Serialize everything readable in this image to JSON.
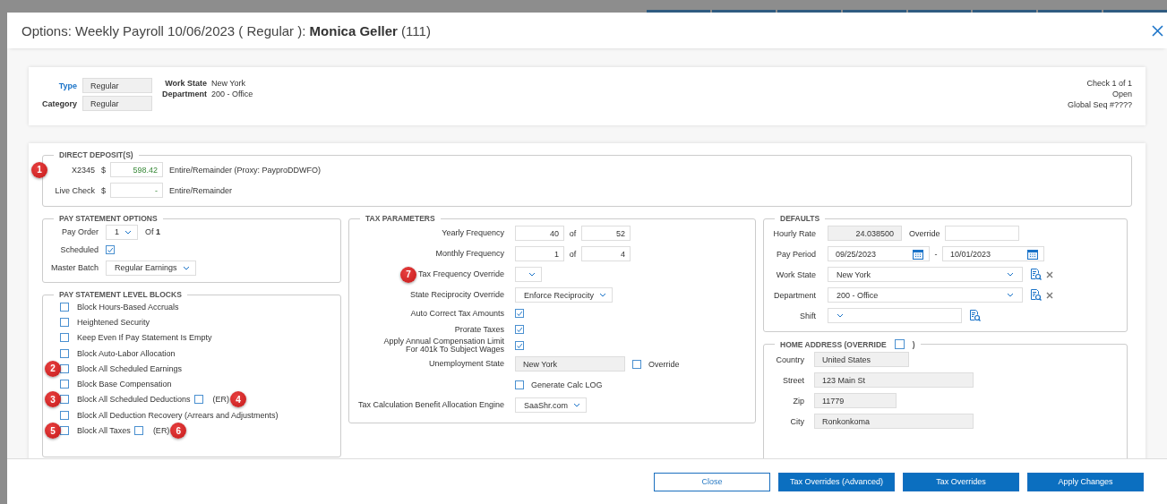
{
  "dialog": {
    "title": "Options: Weekly Payroll 10/06/2023 ( Regular ): ",
    "employee_name": "Monica Geller",
    "employee_id": "(111)"
  },
  "summary": {
    "fields": [
      {
        "label": "Type",
        "value": "Regular",
        "link": true
      },
      {
        "label": "Category",
        "value": "Regular",
        "link": false
      }
    ],
    "info": [
      {
        "label": "Work State",
        "value": "New York"
      },
      {
        "label": "Department",
        "value": "200 - Office"
      }
    ],
    "status_lines": [
      "Check 1 of 1",
      "Open",
      "Global Seq #????"
    ]
  },
  "direct_deposits": {
    "title": "DIRECT DEPOSIT(S)",
    "rows": [
      {
        "account": "X2345",
        "currency": "$",
        "amount": "598.42",
        "description": "Entire/Remainder  (Proxy: PayproDDWFO)",
        "marker": "1"
      },
      {
        "account": "Live Check",
        "currency": "$",
        "amount": "-",
        "description": "Entire/Remainder"
      }
    ]
  },
  "pay_statement_options": {
    "title": "PAY STATEMENT OPTIONS",
    "pay_order_label": "Pay Order",
    "pay_order": "1",
    "of_text": "Of **1**",
    "scheduled_label": "Scheduled",
    "scheduled": true,
    "master_batch_label": "Master Batch",
    "master_batch": "Regular Earnings"
  },
  "level_blocks": {
    "title": "PAY STATEMENT LEVEL BLOCKS",
    "items": [
      {
        "label": "Block Hours-Based Accruals",
        "checked": false
      },
      {
        "label": "Heightened Security",
        "checked": false
      },
      {
        "label": "Keep Even If Pay Statement Is Empty",
        "checked": false
      },
      {
        "label": "Block Auto-Labor Allocation",
        "checked": false
      },
      {
        "label": "Block All Scheduled Earnings",
        "checked": false,
        "marker": "2"
      },
      {
        "label": "Block Base Compensation",
        "checked": false
      },
      {
        "label": "Block All Scheduled Deductions",
        "checked": false,
        "marker": "3",
        "er": {
          "label": "(ER)",
          "checked": false,
          "marker": "4"
        }
      },
      {
        "label": "Block All Deduction Recovery (Arrears and Adjustments)",
        "checked": false
      },
      {
        "label": "Block All Taxes",
        "checked": false,
        "marker": "5",
        "er": {
          "label": "(ER)",
          "checked": false,
          "marker": "6"
        }
      }
    ]
  },
  "tax_parameters": {
    "title": "TAX PARAMETERS",
    "rows": [
      {
        "kind": "pair",
        "label": "Yearly Frequency",
        "value": "40",
        "of": "of",
        "total": "52"
      },
      {
        "kind": "pair",
        "label": "Monthly Frequency",
        "value": "1",
        "of": "of",
        "total": "4"
      },
      {
        "kind": "select",
        "label": "Tax Frequency Override",
        "marker": "7"
      },
      {
        "kind": "select",
        "label": "State Reciprocity Override",
        "value": "Enforce Reciprocity"
      },
      {
        "kind": "check",
        "label": "Auto Correct Tax Amounts",
        "checked": true
      },
      {
        "kind": "check",
        "label": "Prorate Taxes",
        "checked": true
      },
      {
        "kind": "check",
        "label": "Apply Annual Compensation Limit\nFor 401k To Subject Wages",
        "checked": true
      },
      {
        "kind": "readonly",
        "label": "Unemployment State",
        "value": "New York",
        "override_label": "Override",
        "override": false
      },
      {
        "kind": "option",
        "option_label": "Generate Calc LOG",
        "checked": false
      },
      {
        "kind": "select",
        "label": "Tax Calculation Benefit Allocation Engine",
        "value": "SaaShr.com"
      }
    ]
  },
  "defaults": {
    "title": "DEFAULTS",
    "rows": [
      {
        "kind": "rate",
        "label": "Hourly Rate",
        "value": "24.038500",
        "override_label": "Override"
      },
      {
        "kind": "period",
        "label": "Pay Period",
        "start": "09/25/2023",
        "separator": "-",
        "end": "10/01/2023"
      },
      {
        "kind": "lookup",
        "label": "Work State",
        "value": "New York",
        "clearable": true
      },
      {
        "kind": "lookup",
        "label": "Department",
        "value": "200 - Office",
        "clearable": true
      },
      {
        "kind": "lookup",
        "label": "Shift",
        "clearable": false
      }
    ]
  },
  "home_address": {
    "title": "HOME ADDRESS (OVERRIDE",
    "title_end": ")",
    "override": false,
    "fields": [
      {
        "label": "Country",
        "value": "United States"
      },
      {
        "label": "Street",
        "value": "123 Main St"
      },
      {
        "label": "Zip",
        "value": "11779"
      },
      {
        "label": "City",
        "value": "Ronkonkoma"
      }
    ]
  },
  "buttons": [
    {
      "label": "Close",
      "kind": "secondary"
    },
    {
      "label": "Tax Overrides (Advanced)",
      "kind": "primary"
    },
    {
      "label": "Tax Overrides",
      "kind": "primary"
    },
    {
      "label": "Apply Changes",
      "kind": "primary"
    }
  ]
}
